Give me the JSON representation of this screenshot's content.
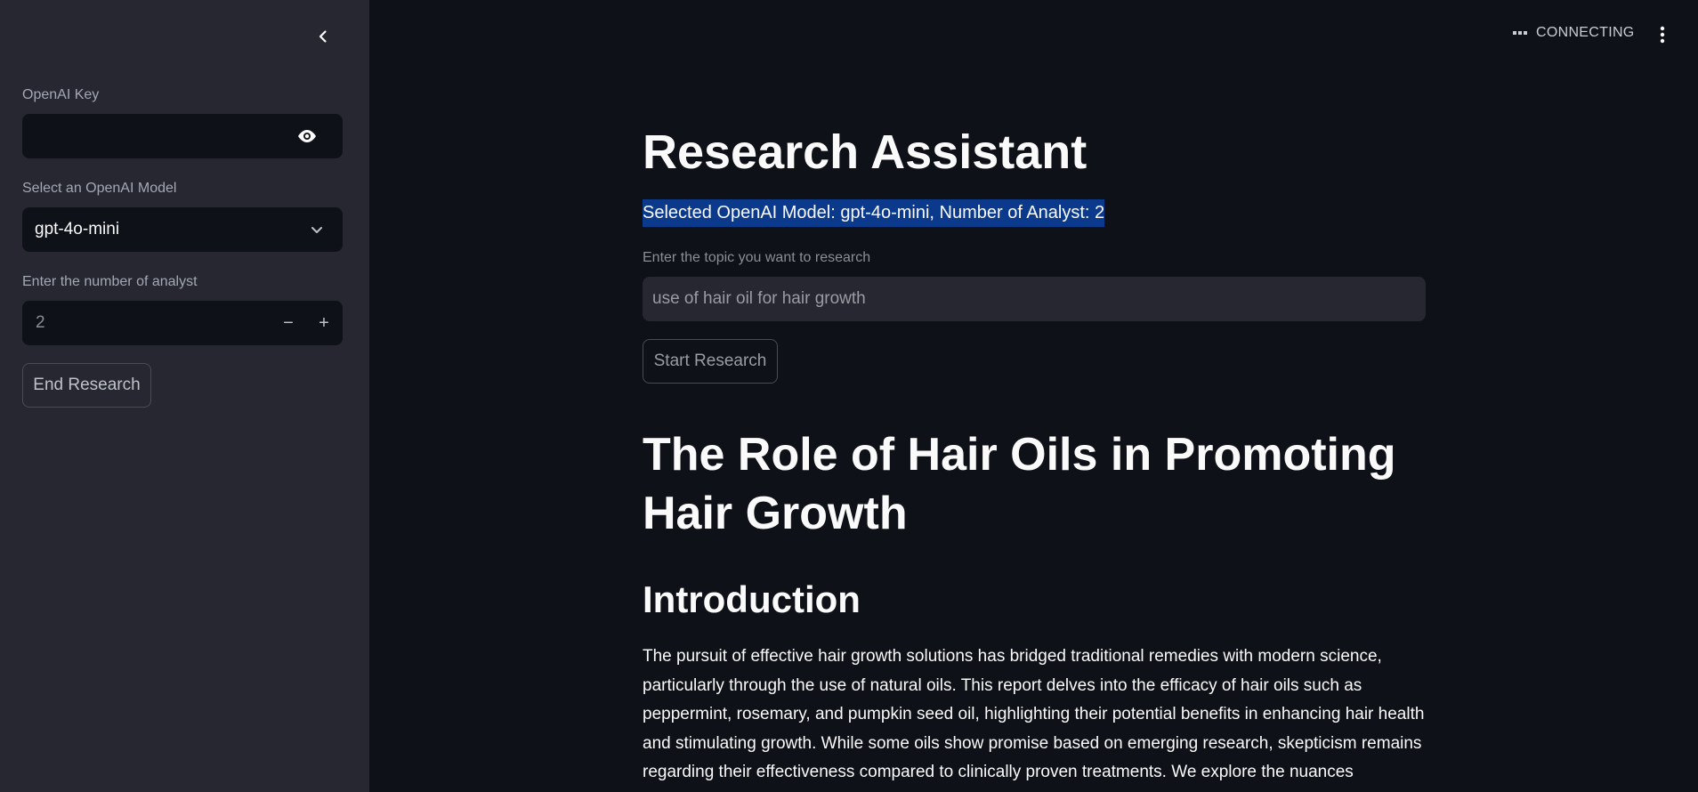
{
  "sidebar": {
    "openai_key_label": "OpenAI Key",
    "openai_key_value": "",
    "model_label": "Select an OpenAI Model",
    "model_selected": "gpt-4o-mini",
    "analyst_label": "Enter the number of analyst",
    "analyst_value": "2",
    "decrement_label": "−",
    "increment_label": "+",
    "end_button": "End Research"
  },
  "header": {
    "status_text": "CONNECTING"
  },
  "main": {
    "title": "Research Assistant",
    "selected_info": "Selected OpenAI Model: gpt-4o-mini, Number of Analyst: 2",
    "topic_label": "Enter the topic you want to research",
    "topic_value": "use of hair oil for hair growth",
    "start_button": "Start Research",
    "report_title": "The Role of Hair Oils in Promoting Hair Growth",
    "intro_heading": "Introduction",
    "intro_text": "The pursuit of effective hair growth solutions has bridged traditional remedies with modern science, particularly through the use of natural oils. This report delves into the efficacy of hair oils such as peppermint, rosemary, and pumpkin seed oil, highlighting their potential benefits in enhancing hair health and stimulating growth. While some oils show promise based on emerging research, skepticism remains regarding their effectiveness compared to clinically proven treatments. We explore the nuances"
  },
  "colors": {
    "background": "#0e1117",
    "sidebar": "#262730",
    "highlight": "#0b3a8c"
  }
}
